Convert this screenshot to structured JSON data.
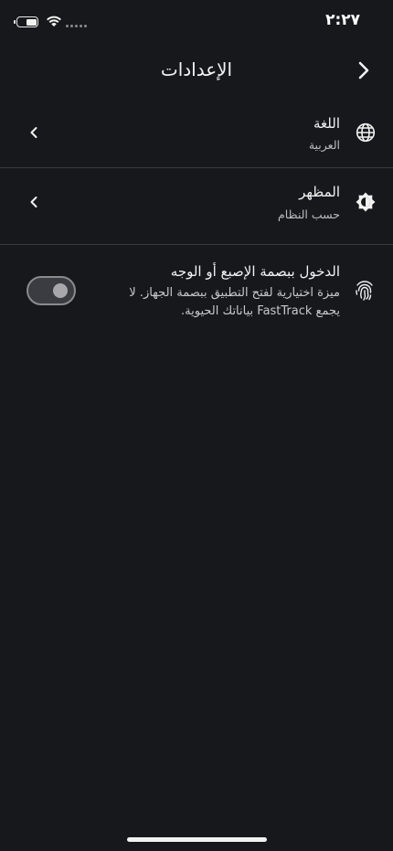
{
  "status_bar": {
    "time": "٢:٢٧",
    "battery_icon": "battery-icon",
    "wifi_icon": "wifi-icon",
    "signal_icon": "signal-icon"
  },
  "header": {
    "title": "الإعدادات",
    "back_icon": "chevron-right-icon"
  },
  "settings": {
    "language": {
      "title": "اللغة",
      "value": "العربية",
      "icon": "globe-icon"
    },
    "appearance": {
      "title": "المظهر",
      "value": "حسب النظام",
      "icon": "brightness-icon"
    },
    "biometric": {
      "title": "الدخول ببصمة الإصبع أو الوجه",
      "description": "ميزة اختيارية لفتح التطبيق ببصمة الجهاز. لا يجمع FastTrack بياناتك الحيوية.",
      "icon": "fingerprint-icon",
      "enabled": false
    }
  },
  "colors": {
    "background": "#17181c",
    "text": "#f3f3f3",
    "secondary_text": "#bdbdc1",
    "divider": "#3a3b40"
  }
}
